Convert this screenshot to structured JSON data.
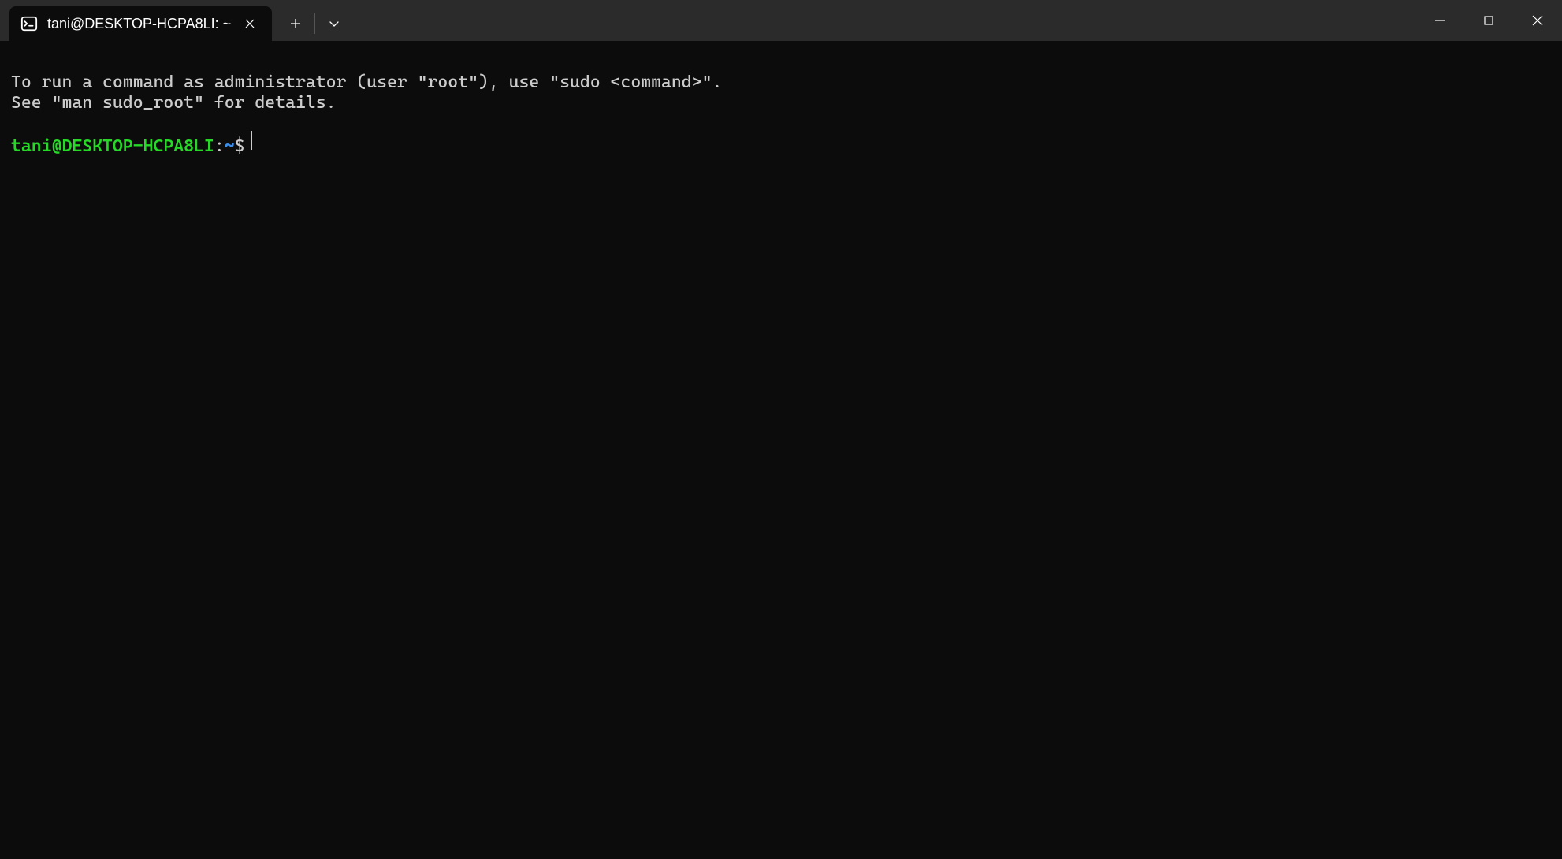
{
  "titlebar": {
    "tab": {
      "title": "tani@DESKTOP-HCPA8LI: ~",
      "icon": "terminal-icon"
    }
  },
  "terminal": {
    "motd": [
      "To run a command as administrator (user \"root\"), use \"sudo <command>\".",
      "See \"man sudo_root\" for details."
    ],
    "prompt": {
      "user_host": "tani@DESKTOP-HCPA8LI",
      "colon": ":",
      "path": "~",
      "symbol": "$"
    },
    "colors": {
      "background": "#0c0c0c",
      "foreground": "#cccccc",
      "prompt_user": "#26d926",
      "prompt_path": "#3b8eea"
    }
  }
}
